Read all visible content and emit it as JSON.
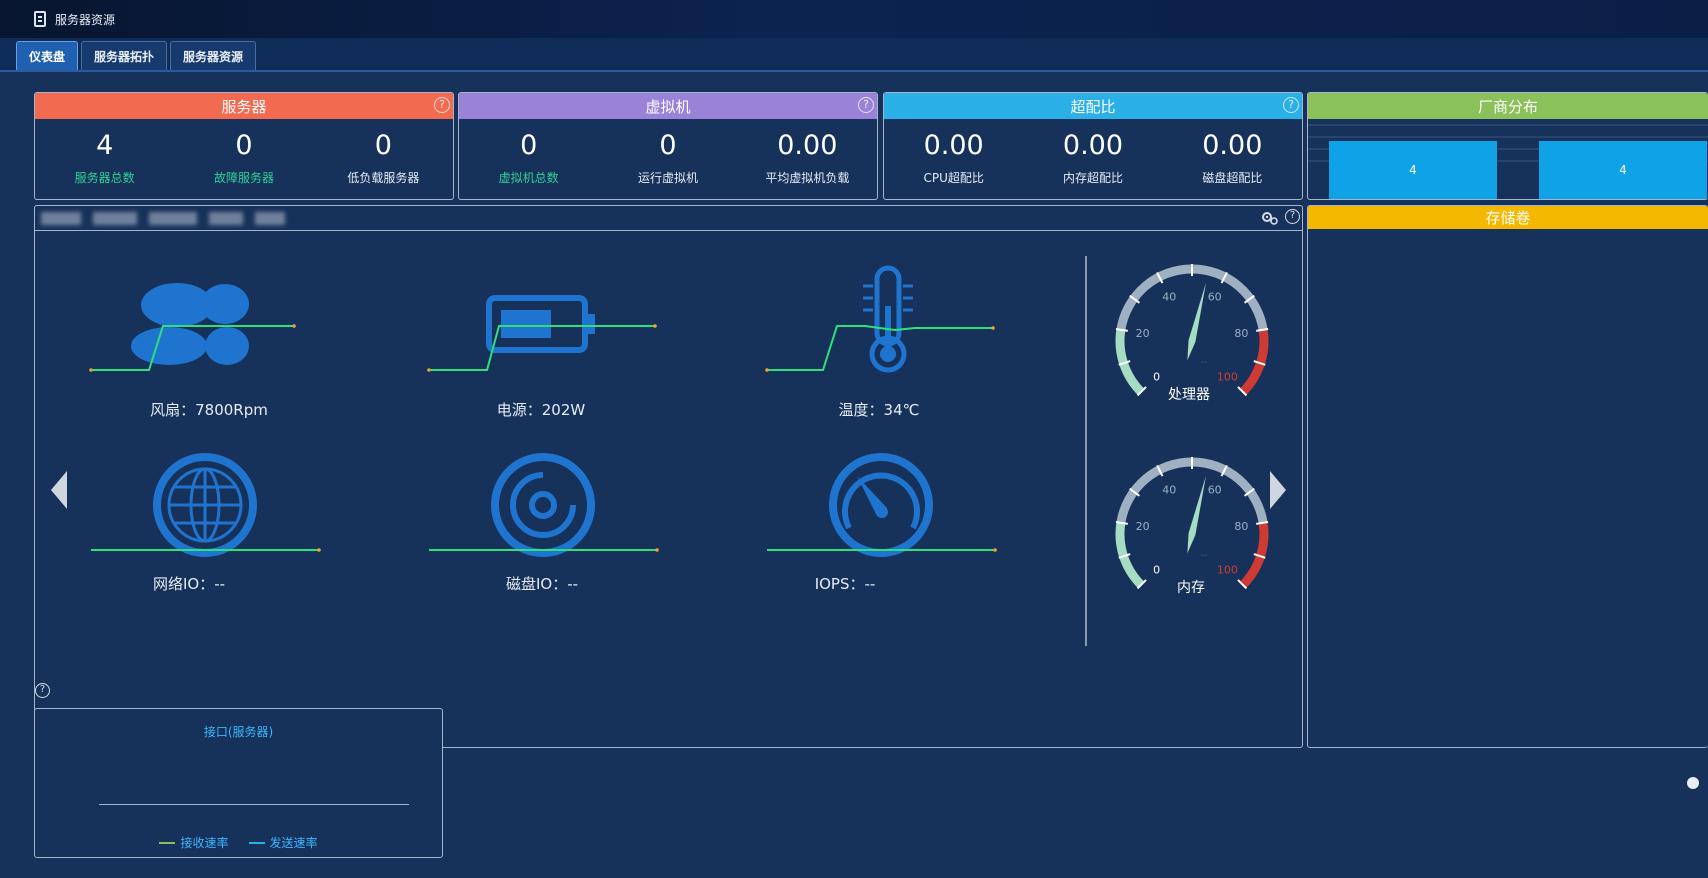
{
  "window": {
    "title": "服务器资源",
    "icon": "server-icon"
  },
  "tabs": [
    {
      "label": "仪表盘",
      "active": true
    },
    {
      "label": "服务器拓扑",
      "active": false
    },
    {
      "label": "服务器资源",
      "active": false
    }
  ],
  "cards": {
    "server": {
      "title": "服务器",
      "color": "#f26b50",
      "stats": [
        {
          "value": "4",
          "label": "服务器总数"
        },
        {
          "value": "0",
          "label": "故障服务器"
        },
        {
          "value": "0",
          "label": "低负载服务器"
        }
      ]
    },
    "vm": {
      "title": "虚拟机",
      "color": "#9a82d8",
      "stats": [
        {
          "value": "0",
          "label": "虚拟机总数"
        },
        {
          "value": "0",
          "label": "运行虚拟机"
        },
        {
          "value": "0.00",
          "label": "平均虚拟机负载"
        }
      ]
    },
    "overcommit": {
      "title": "超配比",
      "color": "#2aafe6",
      "stats": [
        {
          "value": "0.00",
          "label": "CPU超配比"
        },
        {
          "value": "0.00",
          "label": "内存超配比"
        },
        {
          "value": "0.00",
          "label": "磁盘超配比"
        }
      ]
    },
    "vendor": {
      "title": "厂商分布",
      "color": "#8bc15a",
      "bar_color": "#0fa2e6",
      "values": [
        "4",
        "4"
      ]
    }
  },
  "hardware": {
    "items": [
      {
        "label": "风扇：7800Rpm",
        "icon": "fan-icon"
      },
      {
        "label": "电源：202W",
        "icon": "battery-icon"
      },
      {
        "label": "温度：34℃",
        "icon": "thermometer-icon"
      },
      {
        "label": "网络IO：--",
        "icon": "globe-icon"
      },
      {
        "label": "磁盘IO：--",
        "icon": "disk-icon"
      },
      {
        "label": "IOPS：--",
        "icon": "speedometer-icon"
      }
    ],
    "gauges": [
      {
        "label": "处理器",
        "ticks": [
          "0",
          "20",
          "40",
          "60",
          "80",
          "100"
        ],
        "center": "--",
        "value": 55
      },
      {
        "label": "内存",
        "ticks": [
          "0",
          "20",
          "40",
          "60",
          "80",
          "100"
        ],
        "center": "--",
        "value": 55
      }
    ],
    "icons": {
      "settings": "gears-icon",
      "help": "?",
      "prev": "arrow-left-icon",
      "next": "arrow-right-icon"
    }
  },
  "storage": {
    "title": "存储卷",
    "color": "#f5b800"
  },
  "interface": {
    "title": "接口(服务器)",
    "legend": [
      {
        "label": "接收速率",
        "color": "#8bc15a"
      },
      {
        "label": "发送速率",
        "color": "#2aafe6"
      }
    ]
  },
  "colors": {
    "line_green": "#2ee07a",
    "icon_blue": "#1f74d0",
    "gauge_red": "#d03a34",
    "gauge_green": "#a6dcc2",
    "gauge_gray": "#9fb0c3"
  }
}
